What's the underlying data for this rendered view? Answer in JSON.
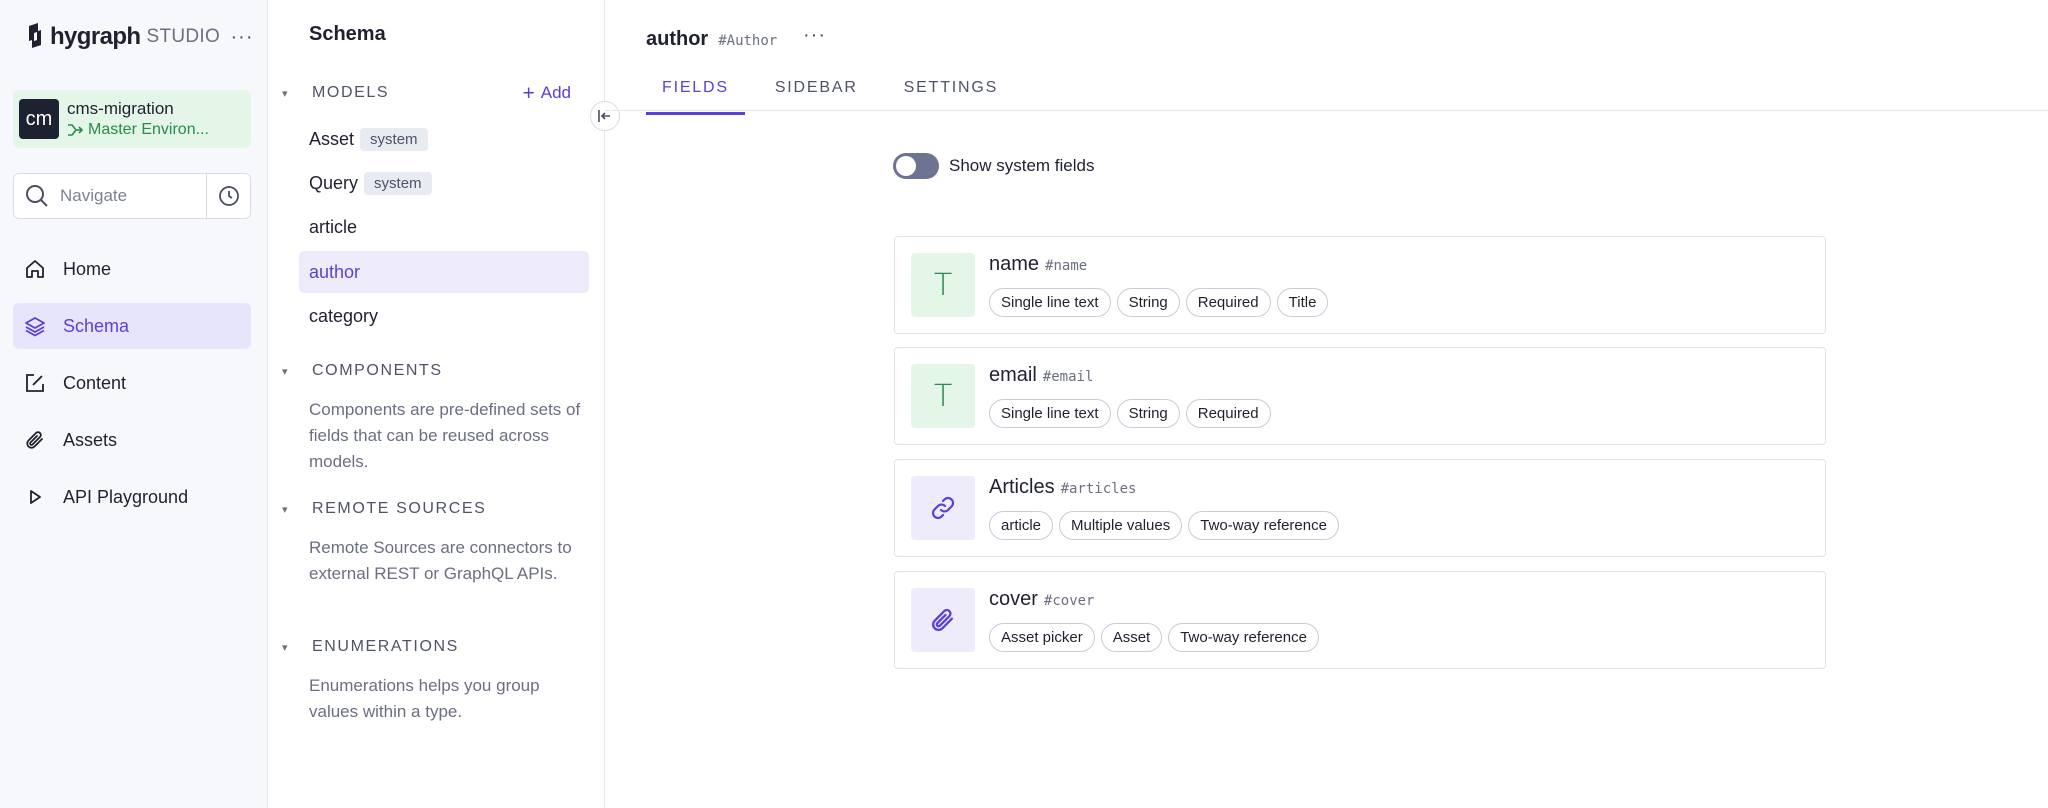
{
  "brand": {
    "name": "hygraph",
    "sub": "STUDIO"
  },
  "project": {
    "avatar": "cm",
    "name": "cms-migration",
    "environment": "Master Environ..."
  },
  "navigate": {
    "placeholder": "Navigate"
  },
  "main_nav": [
    {
      "label": "Home",
      "icon": "home-icon"
    },
    {
      "label": "Schema",
      "icon": "layers-icon",
      "active": true
    },
    {
      "label": "Content",
      "icon": "edit-icon"
    },
    {
      "label": "Assets",
      "icon": "paperclip-icon"
    },
    {
      "label": "API Playground",
      "icon": "play-icon"
    }
  ],
  "schema": {
    "title": "Schema",
    "models_label": "MODELS",
    "add_label": "Add",
    "models": [
      {
        "label": "Asset",
        "badge": "system"
      },
      {
        "label": "Query",
        "badge": "system"
      },
      {
        "label": "article"
      },
      {
        "label": "author",
        "active": true
      },
      {
        "label": "category"
      }
    ],
    "components_label": "COMPONENTS",
    "components_desc": "Components are pre-defined sets of fields that can be reused across models.",
    "remote_label": "REMOTE SOURCES",
    "remote_desc": "Remote Sources are connectors to external REST or GraphQL APIs.",
    "enums_label": "ENUMERATIONS",
    "enums_desc": "Enumerations helps you group values within a type."
  },
  "model": {
    "name": "author",
    "api_id": "#Author",
    "tabs": [
      "FIELDS",
      "SIDEBAR",
      "SETTINGS"
    ],
    "active_tab": "FIELDS",
    "toggle_label": "Show system fields",
    "toggle_on": false
  },
  "fields": [
    {
      "name": "name",
      "api_id": "#name",
      "icon": "T",
      "icon_type": "text",
      "chips": [
        "Single line text",
        "String",
        "Required",
        "Title"
      ]
    },
    {
      "name": "email",
      "api_id": "#email",
      "icon": "T",
      "icon_type": "text",
      "chips": [
        "Single line text",
        "String",
        "Required"
      ]
    },
    {
      "name": "Articles",
      "api_id": "#articles",
      "icon": "link-icon",
      "icon_type": "ref",
      "chips": [
        "article",
        "Multiple values",
        "Two-way reference"
      ]
    },
    {
      "name": "cover",
      "api_id": "#cover",
      "icon": "paperclip-icon",
      "icon_type": "ref",
      "chips": [
        "Asset picker",
        "Asset",
        "Two-way reference"
      ]
    }
  ],
  "colors": {
    "accent": "#5b3fd6",
    "green": "#2a8a4a",
    "env_bg": "#e3f6e8",
    "active_bg": "#e7e5fb"
  }
}
